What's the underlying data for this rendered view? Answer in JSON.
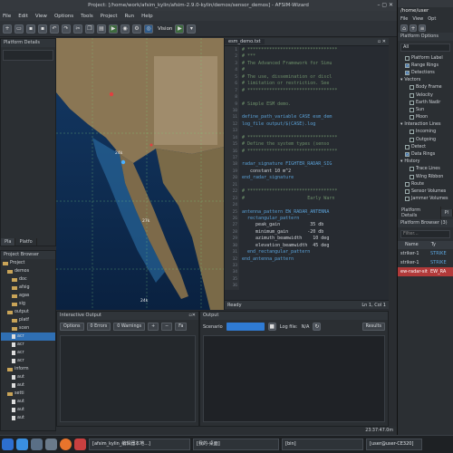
{
  "titlebar": {
    "title": "Project: [/home/work/afsim_kylin/afsim-2.9.0-kylin/demos/sensor_demos] - AFSIM-Wizard"
  },
  "menubar": [
    "File",
    "Edit",
    "View",
    "Options",
    "Tools",
    "Project",
    "Run",
    "Help"
  ],
  "toolbar": {
    "vision_label": "Vision"
  },
  "platform_details": {
    "title": "Platform Details",
    "tabs": [
      "Pla",
      "Platfo"
    ]
  },
  "project_browser": {
    "title": "Project Browser",
    "items": [
      {
        "label": "Project",
        "type": "folder",
        "indent": 0
      },
      {
        "label": "demos",
        "type": "folder",
        "indent": 1
      },
      {
        "label": "doc",
        "type": "folder",
        "indent": 2
      },
      {
        "label": "afsig",
        "type": "folder",
        "indent": 2
      },
      {
        "label": "agas",
        "type": "folder",
        "indent": 2
      },
      {
        "label": "sig",
        "type": "folder",
        "indent": 2
      },
      {
        "label": "output",
        "type": "folder",
        "indent": 1
      },
      {
        "label": "platf",
        "type": "folder",
        "indent": 2
      },
      {
        "label": "scen",
        "type": "folder",
        "indent": 2
      },
      {
        "label": "acr",
        "type": "file",
        "indent": 2,
        "selected": true
      },
      {
        "label": "acr",
        "type": "file",
        "indent": 2
      },
      {
        "label": "acr",
        "type": "file",
        "indent": 2
      },
      {
        "label": "acr",
        "type": "file",
        "indent": 2
      },
      {
        "label": "inform",
        "type": "folder",
        "indent": 1
      },
      {
        "label": "aut",
        "type": "file",
        "indent": 2
      },
      {
        "label": "aut",
        "type": "file",
        "indent": 2
      },
      {
        "label": "setti",
        "type": "folder",
        "indent": 1
      },
      {
        "label": "aut",
        "type": "file",
        "indent": 2
      },
      {
        "label": "aut",
        "type": "file",
        "indent": 2
      },
      {
        "label": "aut",
        "type": "file",
        "indent": 2
      }
    ]
  },
  "map": {
    "labels": [
      "24k",
      "27k",
      "24k"
    ]
  },
  "editor": {
    "tab": "esm_demo.txt",
    "lines": [
      {
        "n": "1",
        "t": "# *********************************",
        "k": "com"
      },
      {
        "n": "2",
        "t": "# ***",
        "k": "com"
      },
      {
        "n": "3",
        "t": "# The Advanced Framework for Simu",
        "k": "com"
      },
      {
        "n": "4",
        "t": "#",
        "k": "com"
      },
      {
        "n": "5",
        "t": "# The use, dissemination or discl",
        "k": "com"
      },
      {
        "n": "6",
        "t": "# limitation or restriction. See",
        "k": "com"
      },
      {
        "n": "7",
        "t": "# *********************************",
        "k": "com"
      },
      {
        "n": "8",
        "t": "",
        "k": "def"
      },
      {
        "n": "9",
        "t": "# Simple ESM demo.",
        "k": "com"
      },
      {
        "n": "10",
        "t": "",
        "k": "def"
      },
      {
        "n": "11",
        "t": "define_path_variable CASE esm_dem",
        "k": "kw"
      },
      {
        "n": "12",
        "t": "log_file output/$(CASE).log",
        "k": "kw"
      },
      {
        "n": "13",
        "t": "",
        "k": "def"
      },
      {
        "n": "14",
        "t": "# *********************************",
        "k": "com"
      },
      {
        "n": "15",
        "t": "# Define the system types (senso",
        "k": "com"
      },
      {
        "n": "16",
        "t": "# *********************************",
        "k": "com"
      },
      {
        "n": "17",
        "t": "",
        "k": "def"
      },
      {
        "n": "18",
        "t": "radar_signature FIGHTER_RADAR_SIG",
        "k": "kw"
      },
      {
        "n": "19",
        "t": "   constant 10 m^2",
        "k": "def"
      },
      {
        "n": "20",
        "t": "end_radar_signature",
        "k": "kw"
      },
      {
        "n": "21",
        "t": "",
        "k": "def"
      },
      {
        "n": "22",
        "t": "# *********************************",
        "k": "com"
      },
      {
        "n": "23",
        "t": "#                       Early Warn",
        "k": "com"
      },
      {
        "n": "24",
        "t": "",
        "k": "def"
      },
      {
        "n": "25",
        "t": "antenna_pattern EW_RADAR_ANTENNA",
        "k": "kw"
      },
      {
        "n": "26",
        "t": "  rectangular_pattern",
        "k": "kw"
      },
      {
        "n": "27",
        "t": "     peak_gain           35 db",
        "k": "def"
      },
      {
        "n": "28",
        "t": "     minimum_gain       -20 db",
        "k": "def"
      },
      {
        "n": "29",
        "t": "     azimuth_beamwidth    10 deg",
        "k": "def"
      },
      {
        "n": "30",
        "t": "     elevation_beamwidth  45 deg",
        "k": "def"
      },
      {
        "n": "31",
        "t": "  end_rectangular_pattern",
        "k": "kw"
      },
      {
        "n": "32",
        "t": "end_antenna_pattern",
        "k": "kw"
      },
      {
        "n": "33",
        "t": "",
        "k": "def"
      },
      {
        "n": "34",
        "t": "",
        "k": "def"
      },
      {
        "n": "35",
        "t": "",
        "k": "def"
      },
      {
        "n": "36",
        "t": "",
        "k": "def"
      }
    ],
    "status_left": "Ready",
    "status_right": "Ln 1, Col 1"
  },
  "interactive_output": {
    "title": "Interactive Output",
    "options": "Options",
    "errors": "0 Errors",
    "warnings": "0 Warnings",
    "plus": "+",
    "minus": "−",
    "filter": "Fa"
  },
  "output": {
    "title": "Output",
    "scenario": "Scenario",
    "log_file_label": "Log file:",
    "log_file_value": "N/A",
    "results": "Results"
  },
  "status_clock": "23:37:47.0m",
  "right_window": {
    "path": "/home/user",
    "menu": [
      "File",
      "View",
      "Opt"
    ],
    "options_title": "Platform Options",
    "filter_value": "All",
    "options": [
      {
        "label": "Platform Label",
        "checked": false,
        "indent": 1
      },
      {
        "label": "Range Rings",
        "checked": true,
        "indent": 1
      },
      {
        "label": "Detections",
        "checked": true,
        "indent": 1
      },
      {
        "label": "Vectors",
        "checked": false,
        "indent": 0,
        "group": true
      },
      {
        "label": "Body Frame",
        "checked": false,
        "indent": 2
      },
      {
        "label": "Velocity",
        "checked": false,
        "indent": 2
      },
      {
        "label": "Earth Nadir",
        "checked": false,
        "indent": 2
      },
      {
        "label": "Sun",
        "checked": false,
        "indent": 2
      },
      {
        "label": "Moon",
        "checked": false,
        "indent": 2
      },
      {
        "label": "Interaction Lines",
        "checked": false,
        "indent": 0,
        "group": true
      },
      {
        "label": "Incoming",
        "checked": false,
        "indent": 2
      },
      {
        "label": "Outgoing",
        "checked": false,
        "indent": 2
      },
      {
        "label": "Detect",
        "checked": false,
        "indent": 1
      },
      {
        "label": "Data Rings",
        "checked": true,
        "indent": 1
      },
      {
        "label": "History",
        "checked": false,
        "indent": 0,
        "group": true
      },
      {
        "label": "Trace Lines",
        "checked": false,
        "indent": 2
      },
      {
        "label": "Wing Ribbon",
        "checked": false,
        "indent": 2
      },
      {
        "label": "Route",
        "checked": false,
        "indent": 1
      },
      {
        "label": "Sensor Volumes",
        "checked": false,
        "indent": 1
      },
      {
        "label": "Jammer Volumes",
        "checked": false,
        "indent": 1
      }
    ],
    "tabs": [
      "Platform Details",
      "Pl"
    ],
    "browser_title": "Platform Browser (3)",
    "filter_placeholder": "Filter...",
    "columns": [
      "Name",
      "Ty"
    ],
    "rows": [
      {
        "name": "striker-1",
        "type": "STRIKE",
        "state": "normal"
      },
      {
        "name": "striker-1",
        "type": "STRIKE",
        "state": "normal"
      },
      {
        "name": "ew-radar-site",
        "type": "EW_RA",
        "state": "selected"
      }
    ]
  },
  "taskbar": {
    "windows": [
      "[afsim_kylin_编辑器本地...]",
      "[我的-桌面]",
      "[bin]",
      "[user@user-CE320]"
    ]
  }
}
